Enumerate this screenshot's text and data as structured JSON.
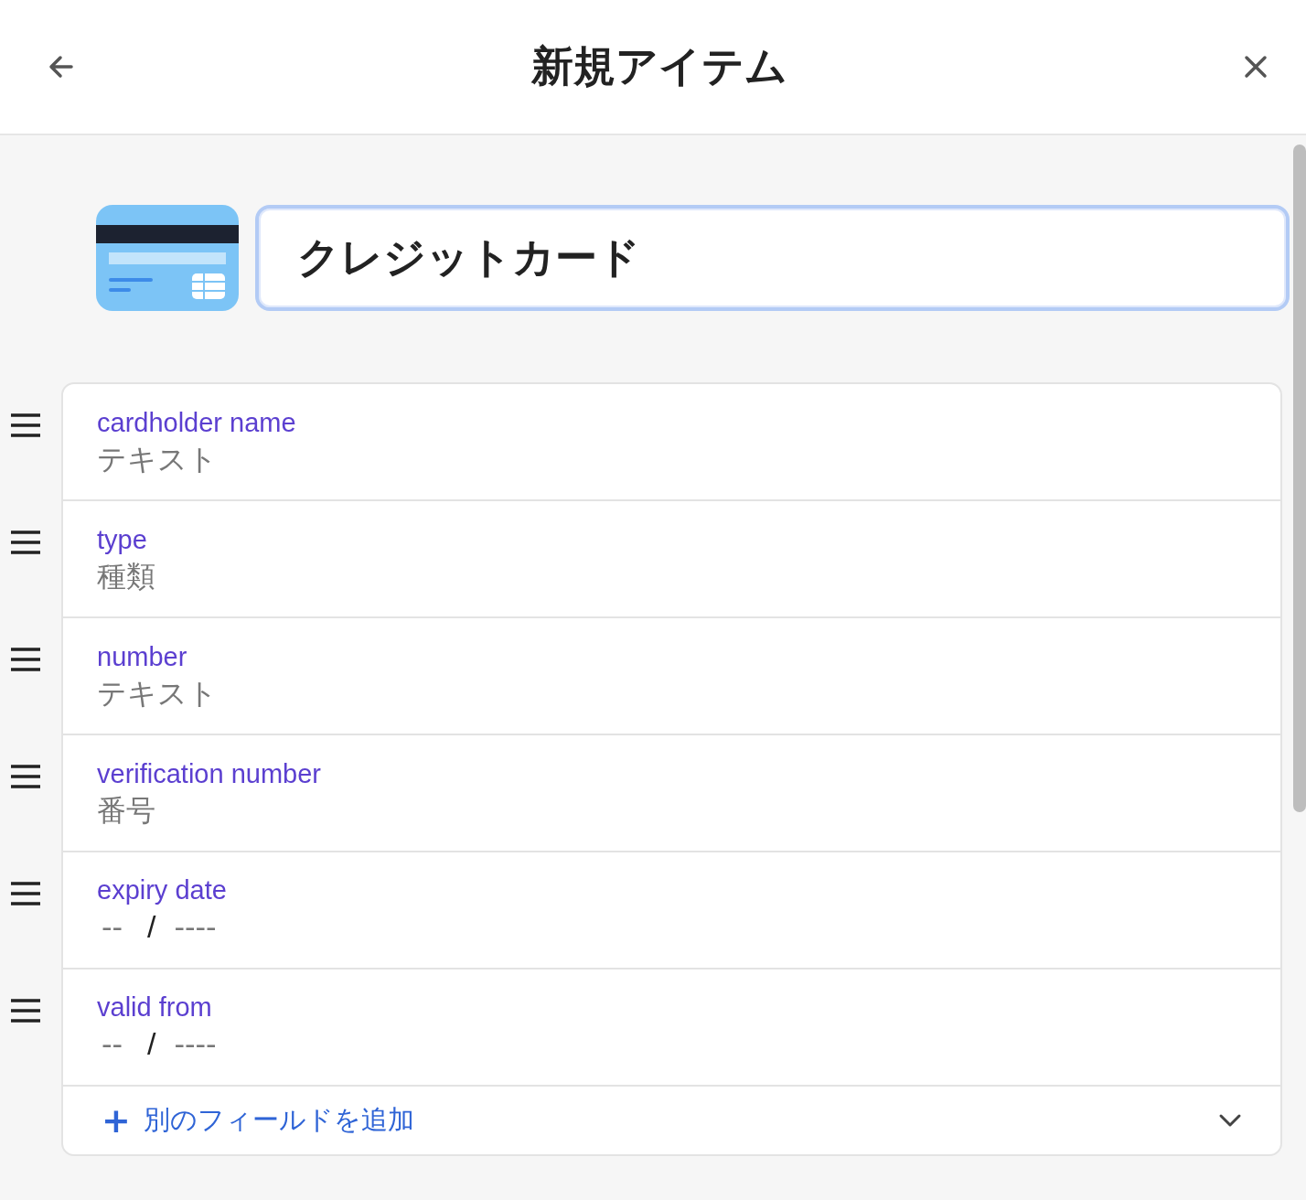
{
  "header": {
    "title": "新規アイテム"
  },
  "item": {
    "title": "クレジットカード"
  },
  "fields": [
    {
      "kind": "text",
      "label": "cardholder name",
      "placeholder": "テキスト"
    },
    {
      "kind": "text",
      "label": "type",
      "placeholder": "種類"
    },
    {
      "kind": "text",
      "label": "number",
      "placeholder": "テキスト"
    },
    {
      "kind": "text",
      "label": "verification number",
      "placeholder": "番号"
    },
    {
      "kind": "date",
      "label": "expiry date",
      "month_placeholder": "--",
      "separator": "/",
      "year_placeholder": "----"
    },
    {
      "kind": "date",
      "label": "valid from",
      "month_placeholder": "--",
      "separator": "/",
      "year_placeholder": "----"
    }
  ],
  "add_field": {
    "plus": "+",
    "label": "別のフィールドを追加"
  }
}
